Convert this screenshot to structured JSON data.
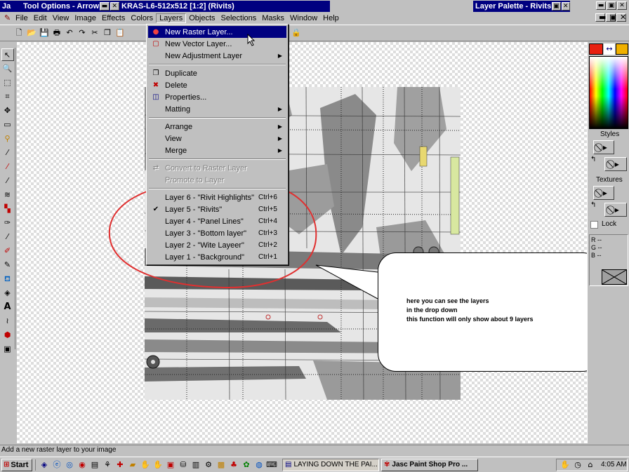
{
  "windows": {
    "app_title_fragment": "Ja",
    "tool_options_title": "Tool Options - Arrow",
    "doc_title": "KRAS-L6-512x512 [1:2] (Rivits)",
    "layer_palette_title": "Layer Palette - Rivits"
  },
  "title_buttons": {
    "min": "▬",
    "max": "▣",
    "close": "✕"
  },
  "menubar": [
    "File",
    "Edit",
    "View",
    "Image",
    "Effects",
    "Colors",
    "Layers",
    "Objects",
    "Selections",
    "Masks",
    "Window",
    "Help"
  ],
  "layers_menu": {
    "group1": [
      {
        "label": "New Raster Layer...",
        "icon": "●"
      },
      {
        "label": "New Vector Layer...",
        "icon": "▢"
      },
      {
        "label": "New Adjustment Layer",
        "icon": "",
        "arrow": "▶"
      }
    ],
    "group2": [
      {
        "label": "Duplicate",
        "icon": "❐"
      },
      {
        "label": "Delete",
        "icon": "✖"
      },
      {
        "label": "Properties...",
        "icon": "◫"
      },
      {
        "label": "Matting",
        "icon": "",
        "arrow": "▶"
      }
    ],
    "group3": [
      {
        "label": "Arrange",
        "arrow": "▶"
      },
      {
        "label": "View",
        "arrow": "▶"
      },
      {
        "label": "Merge",
        "arrow": "▶"
      }
    ],
    "group4": [
      {
        "label": "Convert to Raster Layer",
        "icon": "⇄"
      },
      {
        "label": "Promote to Layer"
      }
    ],
    "layers": [
      {
        "label": "Layer 6 - \"Rivit Highlights\"",
        "shortcut": "Ctrl+6",
        "check": ""
      },
      {
        "label": "Layer 5 - \"Rivits\"",
        "shortcut": "Ctrl+5",
        "check": "✔"
      },
      {
        "label": "Layer 4 - \"Panel Lines\"",
        "shortcut": "Ctrl+4",
        "check": ""
      },
      {
        "label": "Layer 3 - \"Bottom layer\"",
        "shortcut": "Ctrl+3",
        "check": ""
      },
      {
        "label": "Layer 2 - \"Wite Layeer\"",
        "shortcut": "Ctrl+2",
        "check": ""
      },
      {
        "label": "Layer 1 - \"Background\"",
        "shortcut": "Ctrl+1",
        "check": ""
      }
    ]
  },
  "callout": {
    "line1": "here you can see the layers",
    "line2": "in the drop down",
    "line3": "this function will only show about 9 layers"
  },
  "color_palette": {
    "styles_label": "Styles",
    "textures_label": "Textures",
    "lock_label": "Lock",
    "rgb_r": "R  --",
    "rgb_g": "G  --",
    "rgb_b": "B  --",
    "swap": "↔"
  },
  "status_text": "Add a new raster layer to your image",
  "taskbar": {
    "start": "Start",
    "task1": "LAYING DOWN THE PAI...",
    "task2": "Jasc Paint Shop Pro ...",
    "clock": "4:05 AM"
  },
  "colors": {
    "titlebar": "#000080",
    "annotation_circle": "#e03030",
    "foreground_swatch": "#e82010",
    "background_swatch": "#f0b000"
  }
}
